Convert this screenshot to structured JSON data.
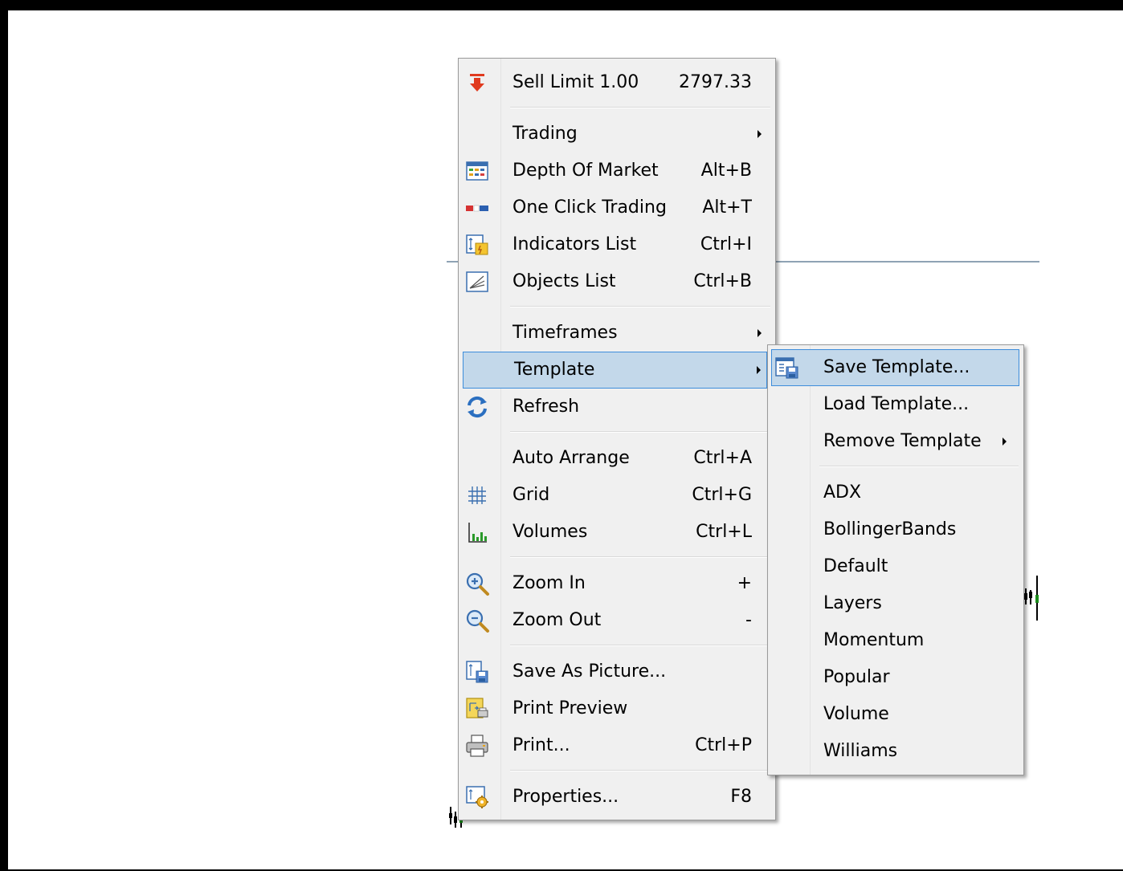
{
  "context_menu": {
    "items": [
      {
        "label": "Sell Limit 1.00",
        "shortcut": "2797.33",
        "icon": "sell-limit-icon"
      },
      {
        "label": "Trading",
        "submenu": true
      },
      {
        "label": "Depth Of Market",
        "shortcut": "Alt+B",
        "icon": "depth-of-market-icon"
      },
      {
        "label": "One Click Trading",
        "shortcut": "Alt+T",
        "icon": "one-click-trading-icon"
      },
      {
        "label": "Indicators List",
        "shortcut": "Ctrl+I",
        "icon": "indicators-list-icon"
      },
      {
        "label": "Objects List",
        "shortcut": "Ctrl+B",
        "icon": "objects-list-icon"
      },
      {
        "label": "Timeframes",
        "submenu": true
      },
      {
        "label": "Template",
        "submenu": true,
        "highlighted": true
      },
      {
        "label": "Refresh",
        "icon": "refresh-icon"
      },
      {
        "label": "Auto Arrange",
        "shortcut": "Ctrl+A"
      },
      {
        "label": "Grid",
        "shortcut": "Ctrl+G",
        "icon": "grid-icon"
      },
      {
        "label": "Volumes",
        "shortcut": "Ctrl+L",
        "icon": "volumes-icon"
      },
      {
        "label": "Zoom In",
        "shortcut": "+",
        "icon": "zoom-in-icon"
      },
      {
        "label": "Zoom Out",
        "shortcut": "-",
        "icon": "zoom-out-icon"
      },
      {
        "label": "Save As Picture...",
        "icon": "save-picture-icon"
      },
      {
        "label": "Print Preview",
        "icon": "print-preview-icon"
      },
      {
        "label": "Print...",
        "shortcut": "Ctrl+P",
        "icon": "printer-icon"
      },
      {
        "label": "Properties...",
        "shortcut": "F8",
        "icon": "properties-icon"
      }
    ]
  },
  "template_submenu": {
    "items": [
      {
        "label": "Save Template...",
        "icon": "save-template-icon",
        "highlighted": true
      },
      {
        "label": "Load Template..."
      },
      {
        "label": "Remove Template",
        "submenu": true
      },
      {
        "label": "ADX"
      },
      {
        "label": "BollingerBands"
      },
      {
        "label": "Default"
      },
      {
        "label": "Layers"
      },
      {
        "label": "Momentum"
      },
      {
        "label": "Popular"
      },
      {
        "label": "Volume"
      },
      {
        "label": "Williams"
      }
    ]
  },
  "colors": {
    "highlight_bg": "#c3d8ea",
    "highlight_border": "#3d8ddb",
    "menu_bg": "#f0f0f0",
    "sell_arrow": "#e03a1e"
  }
}
